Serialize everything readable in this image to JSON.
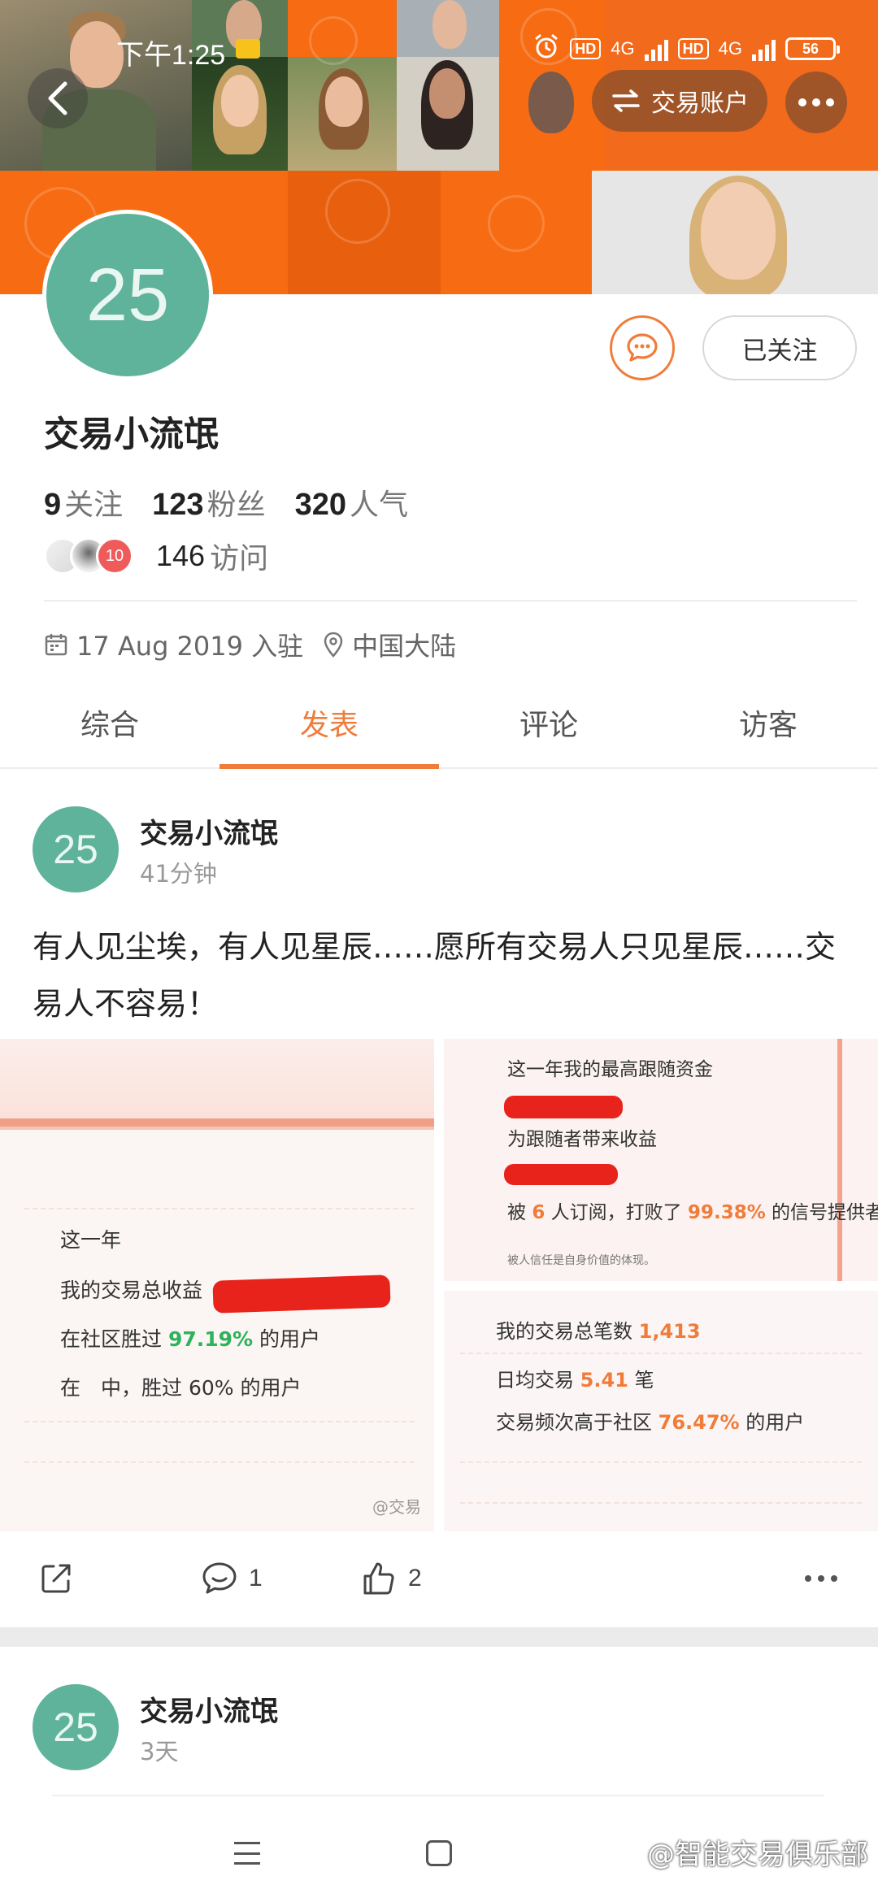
{
  "status_bar": {
    "time": "下午1:25",
    "hd1": "HD",
    "net1": "4G",
    "hd2": "HD",
    "net2": "4G",
    "battery": "56"
  },
  "header": {
    "back_icon": "chevron-left-icon",
    "switch_label": "交易账户",
    "switch_icon": "swap-arrows-icon",
    "more_icon": "more-dots-icon"
  },
  "profile": {
    "avatar_text": "25",
    "avatar_color": "#5fb39a",
    "username": "交易小流氓",
    "follow_label": "已关注",
    "chat_icon": "message-icon",
    "stats": [
      {
        "value": "9",
        "label": "关注"
      },
      {
        "value": "123",
        "label": "粉丝"
      },
      {
        "value": "320",
        "label": "人气"
      }
    ],
    "visitor_badge": "10",
    "visits_count": "146",
    "visits_label": "访问",
    "join_date": "17 Aug 2019 入驻",
    "location": "中国大陆"
  },
  "tabs": [
    {
      "label": "综合",
      "active": false
    },
    {
      "label": "发表",
      "active": true
    },
    {
      "label": "评论",
      "active": false
    },
    {
      "label": "访客",
      "active": false
    }
  ],
  "accent_color": "#f07c3a",
  "post": {
    "avatar_text": "25",
    "author": "交易小流氓",
    "time": "41分钟",
    "text": "有人见尘埃，有人见星辰……愿所有交易人只见星辰……交易人不容易！",
    "images": {
      "left": {
        "line1": "这一年",
        "line2": "我的交易总收益",
        "line3_pre": "在社区胜过 ",
        "line3_val": "97.19%",
        "line3_post": " 的用户",
        "line4": "在　中，胜过 60% 的用户",
        "mark": "@交易"
      },
      "top_right": {
        "line1": "这一年我的最高跟随资金",
        "line2": "为跟随者带来收益",
        "line3_pre": "被 ",
        "line3_val1": "6",
        "line3_mid": " 人订阅，打败了 ",
        "line3_val2": "99.38%",
        "line3_post": " 的信号提供者",
        "line4": "被人信任是自身价值的体现。"
      },
      "bottom_right": {
        "line1_pre": "我的交易总笔数 ",
        "line1_val": "1,413",
        "line2_pre": "日均交易 ",
        "line2_val": "5.41",
        "line2_post": " 笔",
        "line3_pre": "交易频次高于社区 ",
        "line3_val": "76.47%",
        "line3_post": " 的用户"
      }
    },
    "actions": {
      "share_icon": "share-icon",
      "comment_icon": "comment-icon",
      "comment_count": "1",
      "like_icon": "thumbs-up-icon",
      "like_count": "2",
      "more_icon": "more-dots-icon"
    }
  },
  "post2": {
    "avatar_text": "25",
    "author": "交易小流氓",
    "time": "3天"
  },
  "navbar": {
    "menu_icon": "menu-icon",
    "home_icon": "home-square-icon",
    "watermark": "@智能交易俱乐部"
  }
}
